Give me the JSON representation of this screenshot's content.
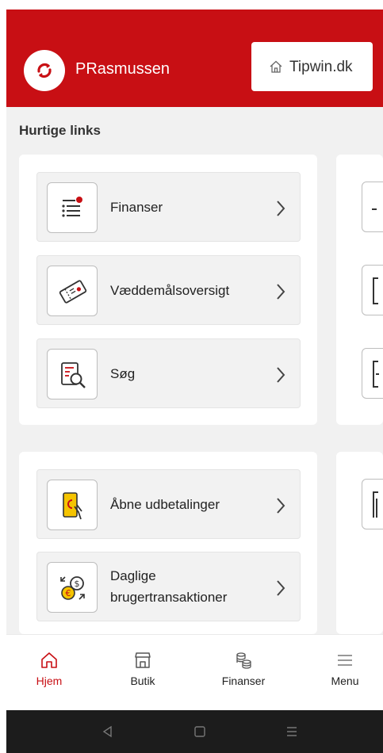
{
  "header": {
    "username": "PRasmussen",
    "site_button_label": "Tipwin.dk",
    "brand_color": "#c80f14"
  },
  "quick_links": {
    "title": "Hurtige links",
    "items": [
      {
        "label": "Finanser",
        "icon": "finance-list-icon"
      },
      {
        "label": "Væddemålsoversigt",
        "icon": "bet-ticket-icon"
      },
      {
        "label": "Søg",
        "icon": "search-document-icon"
      },
      {
        "label": "Åbne udbetalinger",
        "icon": "phone-payout-icon"
      },
      {
        "label_line1": "Daglige",
        "label_line2": "brugertransaktioner",
        "icon": "currency-exchange-icon"
      }
    ]
  },
  "bottom_nav": {
    "items": [
      {
        "label": "Hjem",
        "icon": "home-icon",
        "active": true
      },
      {
        "label": "Butik",
        "icon": "shop-icon"
      },
      {
        "label": "Finanser",
        "icon": "coins-icon"
      },
      {
        "label": "Menu",
        "icon": "hamburger-icon"
      }
    ]
  }
}
